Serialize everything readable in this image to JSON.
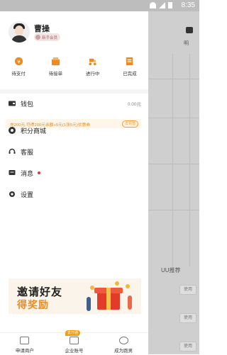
{
  "status_bar": {
    "time": "8:35"
  },
  "profile": {
    "name": "曹操",
    "badge": "新手会员"
  },
  "orders": [
    {
      "label": "待支付",
      "icon": "pay-icon"
    },
    {
      "label": "待接单",
      "icon": "receive-order-icon"
    },
    {
      "label": "进行中",
      "icon": "delivery-icon"
    },
    {
      "label": "已完成",
      "icon": "completed-icon"
    }
  ],
  "wallet": {
    "label": "钱包",
    "value": "0.00元"
  },
  "promo": {
    "text": "充200元,可得200元余额+5元(1张5元)优惠券",
    "button": "去充值"
  },
  "menu": [
    {
      "label": "积分商城",
      "icon": "points-mall-icon"
    },
    {
      "label": "客服",
      "icon": "customer-service-icon"
    },
    {
      "label": "消息",
      "icon": "message-icon",
      "has_dot": true
    },
    {
      "label": "设置",
      "icon": "settings-icon"
    }
  ],
  "banner": {
    "line1": "邀请好友",
    "line2": "得奖励"
  },
  "bottom_nav": [
    {
      "label": "申请商户",
      "icon": "store-icon"
    },
    {
      "label": "企业账号",
      "icon": "enterprise-icon",
      "tag": "去开通"
    },
    {
      "label": "成为跑男",
      "icon": "runner-icon"
    }
  ],
  "overlay": {
    "uu_label": "UU推荐",
    "use_label": "使用",
    "top_note": "明"
  },
  "colors": {
    "accent": "#f08a1a",
    "promo_text": "#e08a1c",
    "red_dot": "#e53935"
  }
}
